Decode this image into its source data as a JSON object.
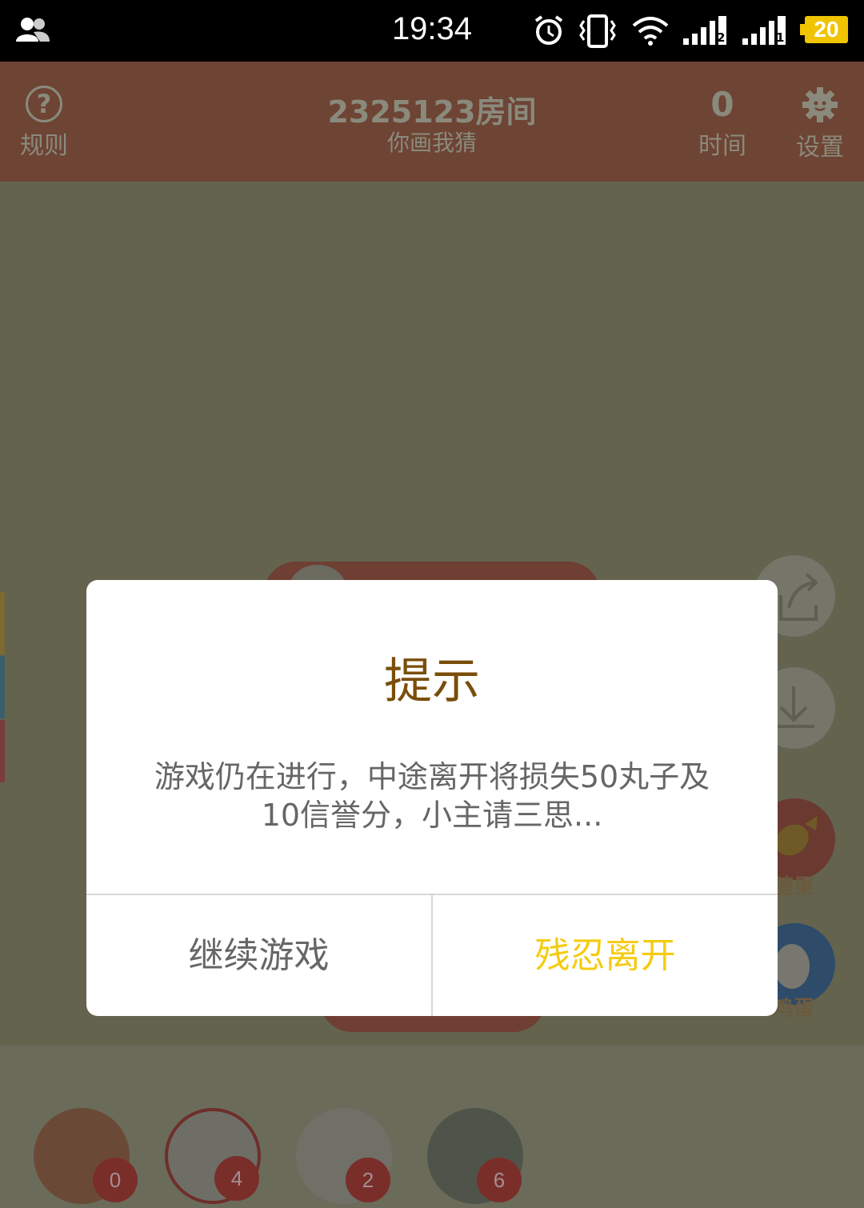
{
  "status_bar": {
    "time": "19:34",
    "sim1_label": "2",
    "sim2_label": "1",
    "battery": "20"
  },
  "header": {
    "rules_label": "规则",
    "room_title": "2325123房间",
    "game_name": "你画我猜",
    "timer_value": "0",
    "timer_label": "时间",
    "settings_label": "设置"
  },
  "side_buttons": {
    "candy_label": "糖果",
    "egg_label": "鸡蛋"
  },
  "players": [
    {
      "score": "0"
    },
    {
      "score": "4"
    },
    {
      "score": "2"
    },
    {
      "score": "6"
    }
  ],
  "dialog": {
    "title": "提示",
    "message_line1": "游戏仍在进行，中途离开将损失50丸子及",
    "message_line2": "10信誉分，小主请三思...",
    "continue_label": "继续游戏",
    "leave_label": "残忍离开"
  },
  "colors": {
    "leave_accent": "#f5cb10",
    "title_color": "#7a4e0a",
    "header_bg": "#6e4434"
  }
}
